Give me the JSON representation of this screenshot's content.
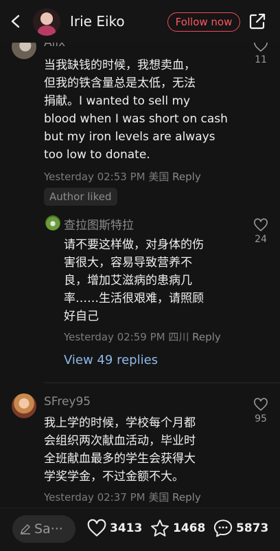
{
  "header": {
    "title": "Irie Eiko",
    "follow_label": "Follow now"
  },
  "comments": [
    {
      "author": "Alix",
      "text_lines": [
        "当我缺钱的时候，我想卖血，",
        "但我的铁含量总是太低，无法",
        "捐献。I wanted to sell my",
        "blood when I was short on cash",
        "but my iron levels are always",
        "too low to donate."
      ],
      "time": "Yesterday 02:53 PM",
      "location": "美国",
      "reply_label": "Reply",
      "likes": "11",
      "badge": "Author liked"
    },
    {
      "author": "查拉图斯特拉",
      "text_lines": [
        "请不要这样做，对身体的伤",
        "害很大，容易导致营养不",
        "良，增加艾滋病的患病几",
        "率……生活很艰难，请照顾",
        "好自己"
      ],
      "time": "Yesterday 02:59 PM",
      "location": "四川",
      "reply_label": "Reply",
      "likes": "24",
      "view_replies": "View 49 replies"
    },
    {
      "author": "SFrey95",
      "text_lines": [
        "我上学的时候，学校每个月都",
        "会组织两次献血活动，毕业时",
        "全班献血最多的学生会获得大",
        "学奖学金，不过金额不大。"
      ],
      "time": "Yesterday 02:37 PM",
      "location": "美国",
      "reply_label": "Reply",
      "likes": "95"
    }
  ],
  "bottom": {
    "input_placeholder": "Sa···",
    "likes": "3413",
    "favorites": "1468",
    "comments": "5873"
  }
}
